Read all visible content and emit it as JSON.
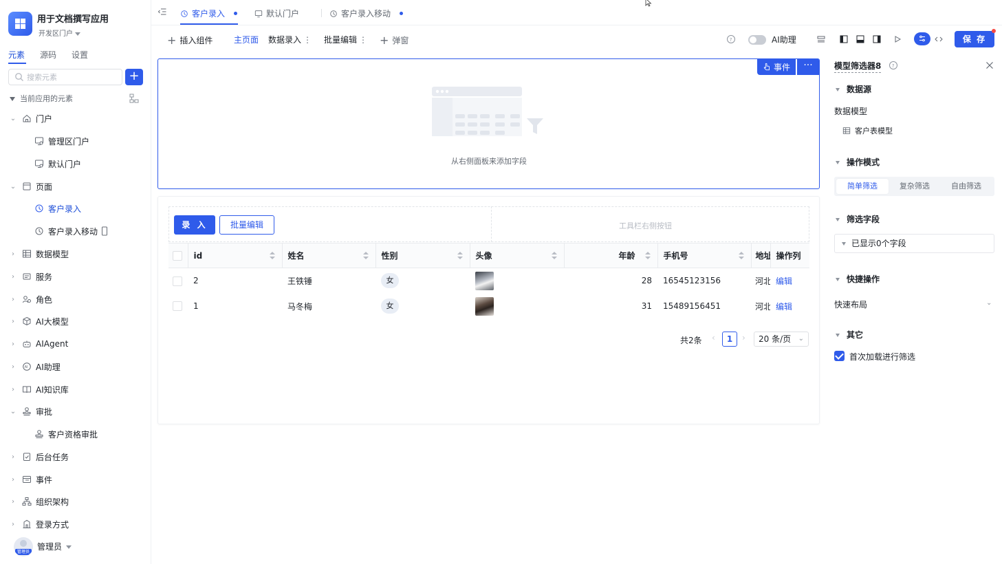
{
  "app": {
    "title": "用于文档撰写应用",
    "subtitle": "开发区门户"
  },
  "sidebar": {
    "tabs": [
      {
        "label": "元素",
        "active": true
      },
      {
        "label": "源码",
        "active": false
      },
      {
        "label": "设置",
        "active": false
      }
    ],
    "search_placeholder": "搜索元素",
    "add_label": "+",
    "tree_header": "当前应用的元素",
    "items": [
      {
        "label": "门户",
        "icon": "home-icon",
        "expanded": true
      },
      {
        "label": "管理区门户",
        "icon": "portal-icon"
      },
      {
        "label": "默认门户",
        "icon": "portal-icon"
      },
      {
        "label": "页面",
        "icon": "page-icon",
        "expanded": true
      },
      {
        "label": "客户录入",
        "icon": "page-link-icon",
        "active": true
      },
      {
        "label": "客户录入移动",
        "icon": "page-link-icon"
      },
      {
        "label": "数据模型",
        "icon": "table-icon"
      },
      {
        "label": "服务",
        "icon": "service-icon"
      },
      {
        "label": "角色",
        "icon": "role-icon"
      },
      {
        "label": "AI大模型",
        "icon": "cube-icon"
      },
      {
        "label": "AIAgent",
        "icon": "robot-icon"
      },
      {
        "label": "AI助理",
        "icon": "ai-icon"
      },
      {
        "label": "AI知识库",
        "icon": "book-icon"
      },
      {
        "label": "审批",
        "icon": "stamp-icon",
        "expanded": true
      },
      {
        "label": "客户资格审批",
        "icon": "stamp-icon"
      },
      {
        "label": "后台任务",
        "icon": "task-icon"
      },
      {
        "label": "事件",
        "icon": "event-icon"
      },
      {
        "label": "组织架构",
        "icon": "org-icon"
      },
      {
        "label": "登录方式",
        "icon": "login-icon"
      }
    ],
    "user": {
      "name": "管理员",
      "avatar_label": "管理员"
    }
  },
  "tabs": [
    {
      "label": "客户录入",
      "active": true,
      "dirty": true
    },
    {
      "label": "默认门户",
      "active": false,
      "dirty": false
    },
    {
      "label": "客户录入移动",
      "active": false,
      "dirty": true
    }
  ],
  "toolbar": {
    "insert": "插入组件",
    "main_page": "主页面",
    "data_entry": "数据录入",
    "batch_edit": "批量编辑",
    "popup": "弹窗",
    "ai_assistant": "AI助理",
    "save": "保 存"
  },
  "canvas": {
    "filter_panel": {
      "event_button": "事件",
      "more_button": "···",
      "empty_hint": "从右侧面板来添加字段"
    },
    "table_panel": {
      "entry_button": "录 入",
      "batch_edit_button": "批量编辑",
      "toolbar_right_hint": "工具栏右侧按钮",
      "columns": [
        "id",
        "姓名",
        "性别",
        "头像",
        "年龄",
        "手机号",
        "地址",
        "操作列"
      ],
      "rows": [
        {
          "id": "2",
          "name": "王铁锤",
          "gender": "女",
          "age": "28",
          "phone": "16545123156",
          "address": "河北",
          "action": "编辑"
        },
        {
          "id": "1",
          "name": "马冬梅",
          "gender": "女",
          "age": "31",
          "phone": "15489156451",
          "address": "河北",
          "action": "编辑"
        }
      ],
      "pagination": {
        "total": "共2条",
        "current_page": "1",
        "page_size": "20 条/页"
      }
    }
  },
  "properties": {
    "title": "模型筛选器8",
    "sections": {
      "datasource": "数据源",
      "data_model_label": "数据模型",
      "data_model_value": "客户表模型",
      "operation_mode": "操作模式",
      "modes": [
        "简单筛选",
        "复杂筛选",
        "自由筛选"
      ],
      "filter_fields": "筛选字段",
      "field_select": "已显示0个字段",
      "quick_actions": "快捷操作",
      "quick_layout": "快速布局",
      "other": "其它",
      "first_load": "首次加载进行筛选"
    }
  },
  "colors": {
    "accent": "#2f5bea",
    "border": "#e8eaed",
    "alert": "#f54a45"
  }
}
